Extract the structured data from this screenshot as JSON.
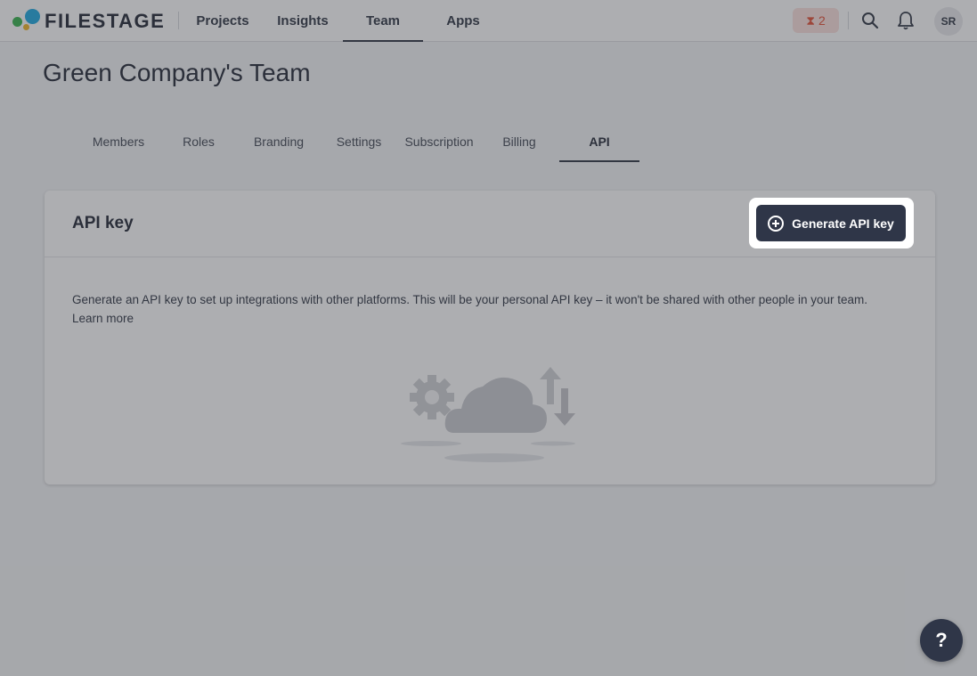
{
  "brand": {
    "name": "FILESTAGE"
  },
  "topnav": {
    "items": [
      {
        "label": "Projects",
        "active": false
      },
      {
        "label": "Insights",
        "active": false
      },
      {
        "label": "Team",
        "active": true
      },
      {
        "label": "Apps",
        "active": false
      }
    ],
    "trial_count": "2",
    "avatar_initials": "SR"
  },
  "page": {
    "title": "Green Company's Team"
  },
  "tabs": [
    {
      "label": "Members"
    },
    {
      "label": "Roles"
    },
    {
      "label": "Branding"
    },
    {
      "label": "Settings"
    },
    {
      "label": "Subscription"
    },
    {
      "label": "Billing"
    },
    {
      "label": "API",
      "active": true
    }
  ],
  "api_card": {
    "title": "API key",
    "generate_button": "Generate API key",
    "description": "Generate an API key to set up integrations with other platforms. This will be your personal API key – it won't be shared with other people in your team.",
    "learn_more": "Learn more"
  },
  "help": {
    "label": "?"
  },
  "colors": {
    "accent": "#2f3648",
    "trial_badge_bg": "#fbe0dc",
    "trial_badge_fg": "#e44c33",
    "overlay": "rgba(60,62,68,0.42)"
  },
  "icons": [
    "search-icon",
    "bell-icon",
    "hourglass-icon",
    "plus-circle-icon",
    "question-icon",
    "cloud-gear-illustration"
  ]
}
